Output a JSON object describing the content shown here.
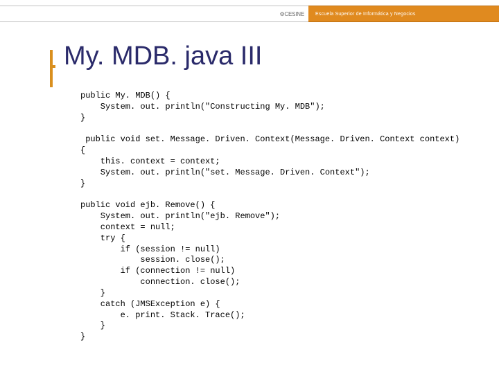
{
  "header": {
    "logo_text": "⚙CESINE",
    "tagline": "Escuela Superior de Informática y Negocios"
  },
  "title": "My. MDB. java III",
  "code": "public My. MDB() {\n    System. out. println(\"Constructing My. MDB\");\n}\n\n public void set. Message. Driven. Context(Message. Driven. Context context)\n{\n    this. context = context;\n    System. out. println(\"set. Message. Driven. Context\");\n}\n\npublic void ejb. Remove() {\n    System. out. println(\"ejb. Remove\");\n    context = null;\n    try {\n        if (session != null)\n            session. close();\n        if (connection != null)\n            connection. close();\n    }\n    catch (JMSException e) {\n        e. print. Stack. Trace();\n    }\n}"
}
